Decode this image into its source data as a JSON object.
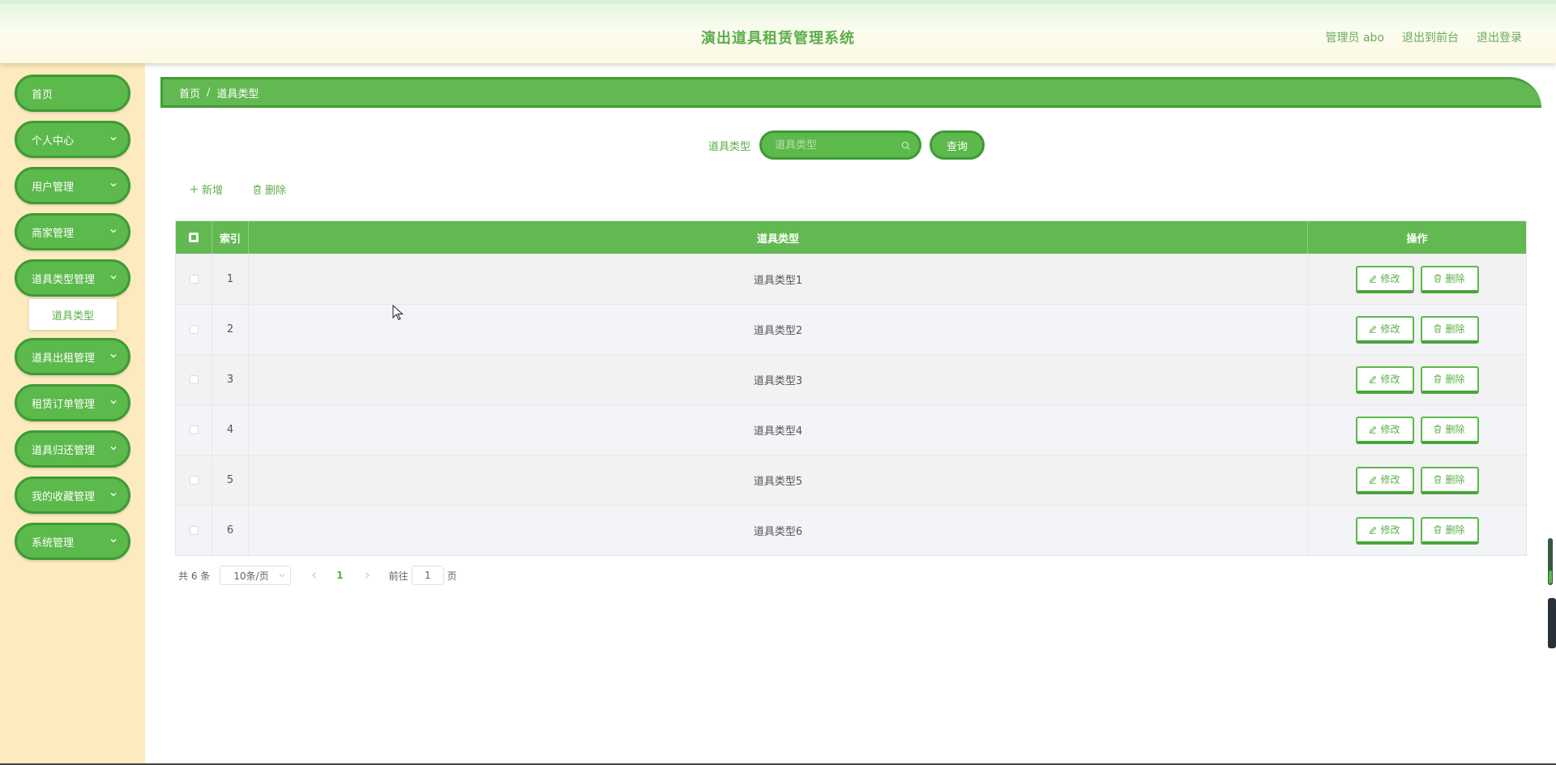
{
  "header": {
    "app_title": "演出道具租赁管理系统",
    "user_label": "管理员 abo",
    "to_frontend": "退出到前台",
    "logout": "退出登录"
  },
  "sidebar": {
    "items": [
      {
        "label": "首页",
        "has_arrow": false
      },
      {
        "label": "个人中心",
        "has_arrow": true
      },
      {
        "label": "用户管理",
        "has_arrow": true
      },
      {
        "label": "商家管理",
        "has_arrow": true
      },
      {
        "label": "道具类型管理",
        "has_arrow": true
      },
      {
        "label": "道具出租管理",
        "has_arrow": true
      },
      {
        "label": "租赁订单管理",
        "has_arrow": true
      },
      {
        "label": "道具归还管理",
        "has_arrow": true
      },
      {
        "label": "我的收藏管理",
        "has_arrow": true
      },
      {
        "label": "系统管理",
        "has_arrow": true
      }
    ],
    "submenu_active": "道具类型"
  },
  "breadcrumb": {
    "home": "首页",
    "separator": "/",
    "current": "道具类型"
  },
  "search": {
    "label": "道具类型",
    "placeholder": "道具类型",
    "value": "",
    "button": "查询"
  },
  "toolbar": {
    "add": "新增",
    "delete": "删除"
  },
  "table": {
    "headers": {
      "index": "索引",
      "type": "道具类型",
      "ops": "操作"
    },
    "rows": [
      {
        "index": "1",
        "type": "道具类型1"
      },
      {
        "index": "2",
        "type": "道具类型2"
      },
      {
        "index": "3",
        "type": "道具类型3"
      },
      {
        "index": "4",
        "type": "道具类型4"
      },
      {
        "index": "5",
        "type": "道具类型5"
      },
      {
        "index": "6",
        "type": "道具类型6"
      }
    ],
    "edit_label": "修改",
    "delete_label": "删除"
  },
  "pagination": {
    "total": "共 6 条",
    "page_size": "10条/页",
    "current_page": "1",
    "goto_prefix": "前往",
    "goto_value": "1",
    "goto_suffix": "页"
  },
  "colors": {
    "primary": "#5cb94b",
    "primary_dark": "#3f9a36",
    "sidebar_bg": "#fdebbf",
    "text_green": "#5cae4a"
  }
}
